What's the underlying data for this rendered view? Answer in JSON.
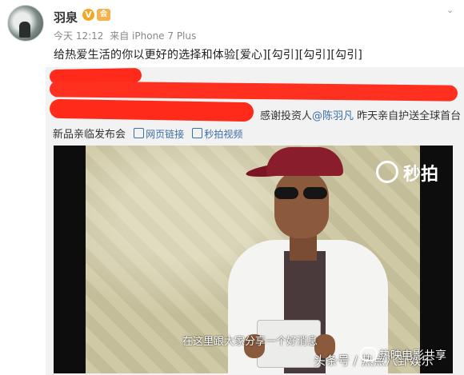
{
  "post": {
    "username": "羽泉",
    "verified_badge": "V",
    "vip_badge": "会",
    "time": "今天 12:12",
    "source": "来自 iPhone 7 Plus",
    "text": "给热爱生活的你以更好的选择和体验[爱心][勾引][勾引][勾引]"
  },
  "repost": {
    "line1_tail": "感谢投资人",
    "mention": "@陈羽凡",
    "line1_end": "昨天亲自护送全球首台",
    "line2": "新品亲临发布会",
    "web_link": "网页链接",
    "video_link": "秒拍视频"
  },
  "video": {
    "brand": "秒拍",
    "subtitle": "在这里跟大家分享一个好消息",
    "watermark_left": "头条号 / 热点八卦娱乐",
    "watermark_right": "热映电影共享"
  },
  "icons": {
    "verify": "verified-v-icon",
    "chevron": "chevron-down-icon",
    "link": "link-icon",
    "video": "video-icon",
    "brand": "miaopai-logo-icon",
    "wechat": "wechat-icon"
  },
  "colors": {
    "link_blue": "#3b6ea5",
    "redaction_red": "#ff2a1a",
    "verify_orange": "#f5a623"
  }
}
